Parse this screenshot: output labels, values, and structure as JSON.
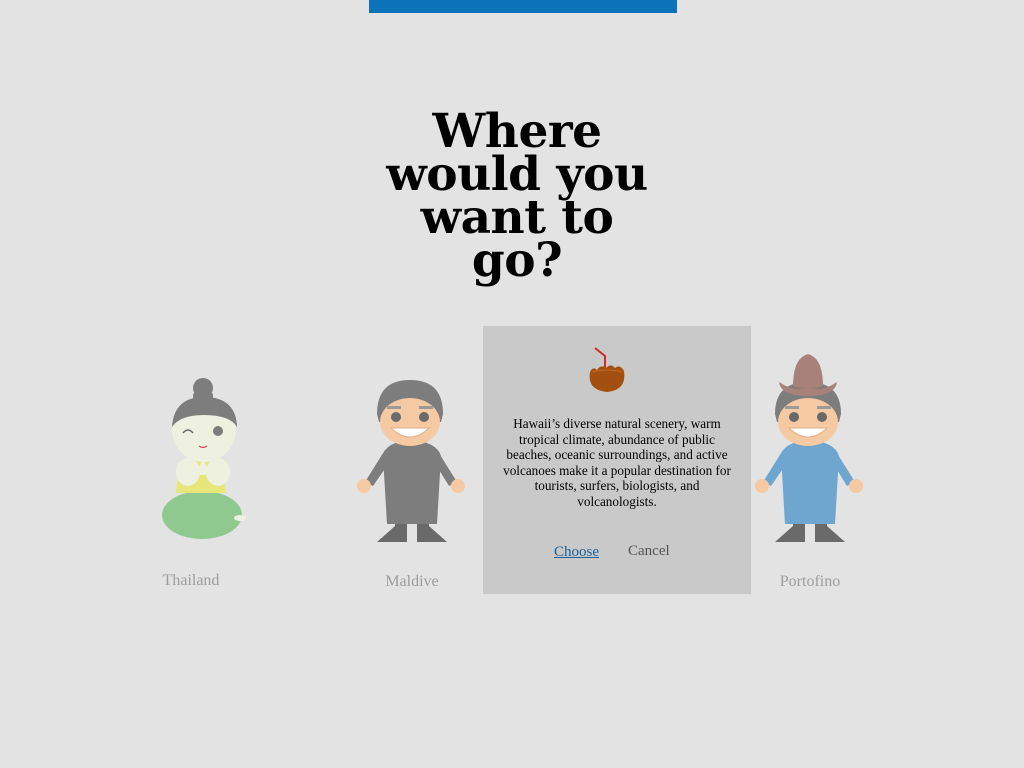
{
  "colors": {
    "background": "#e3e3e3",
    "accent_bar": "#0c73b8",
    "popup_bg": "#c9c9c9",
    "link": "#1c5f97",
    "label": "#9d9d9d"
  },
  "header": {
    "title": "Where\nwould you\nwant to\ngo?"
  },
  "destinations": [
    {
      "label": "Thailand",
      "icon": "thai-woman-kneeling-icon"
    },
    {
      "label": "Maldive",
      "icon": "maldive-man-icon"
    },
    {
      "label": "Portofino",
      "icon": "cowboy-hat-man-icon"
    }
  ],
  "popup": {
    "icon": "coconut-drink-icon",
    "description": "Hawaii’s diverse natural scenery, warm tropical climate, abundance of public beaches, oceanic surroundings, and active volcanoes make it a popular destination for tourists, surfers, biologists, and volcanologists.",
    "choose_label": "Choose",
    "cancel_label": "Cancel"
  }
}
